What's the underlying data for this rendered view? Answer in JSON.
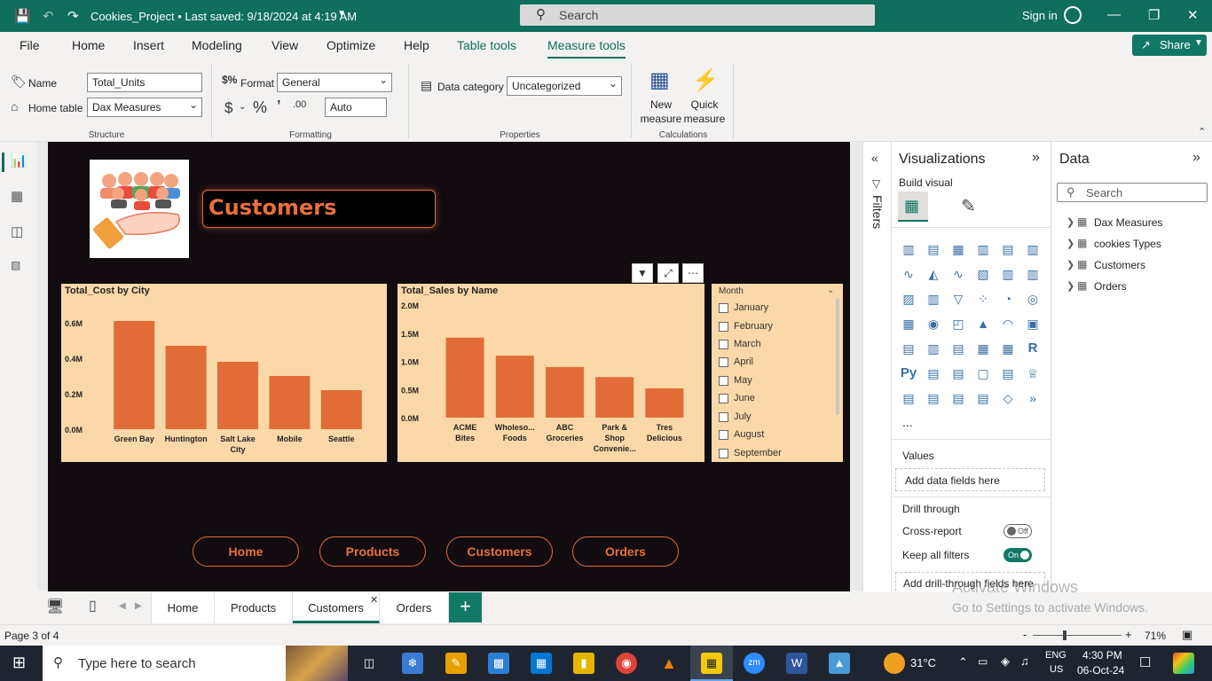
{
  "titlebar": {
    "doc_title": "Cookies_Project • Last saved: 9/18/2024 at 4:19 AM",
    "search_placeholder": "Search",
    "signin": "Sign in"
  },
  "menu": {
    "items": [
      "File",
      "Home",
      "Insert",
      "Modeling",
      "View",
      "Optimize",
      "Help",
      "Table tools",
      "Measure tools"
    ],
    "active": "Measure tools",
    "share": "Share"
  },
  "ribbon": {
    "name_label": "Name",
    "name_value": "Total_Units",
    "home_table_label": "Home table",
    "home_table_value": "Dax Measures",
    "format_label": "Format",
    "format_value": "General",
    "decimal_value": "Auto",
    "data_category_label": "Data category",
    "data_category_value": "Uncategorized",
    "new_measure": "New measure",
    "quick_measure": "Quick measure",
    "groups": {
      "structure": "Structure",
      "formatting": "Formatting",
      "properties": "Properties",
      "calculations": "Calculations"
    }
  },
  "report": {
    "title": "Customers",
    "nav_buttons": [
      "Home",
      "Products",
      "Customers",
      "Orders"
    ]
  },
  "chart_data": [
    {
      "type": "bar",
      "title": "Total_Cost by City",
      "categories": [
        "Green Bay",
        "Huntington",
        "Salt Lake City",
        "Mobile",
        "Seattle"
      ],
      "values": [
        0.61,
        0.47,
        0.38,
        0.3,
        0.22
      ],
      "y_ticks": [
        "0.6M",
        "0.4M",
        "0.2M",
        "0.0M"
      ],
      "ylim": [
        0,
        0.6
      ],
      "unit": "M",
      "color": "#e26c38"
    },
    {
      "type": "bar",
      "title": "Total_Sales by Name",
      "categories": [
        "ACME Bites",
        "Wholeso... Foods",
        "ABC Groceries",
        "Park & Shop Convenie...",
        "Tres Delicious"
      ],
      "values": [
        1.42,
        1.1,
        0.9,
        0.72,
        0.52
      ],
      "y_ticks": [
        "2.0M",
        "1.5M",
        "1.0M",
        "0.5M",
        "0.0M"
      ],
      "ylim": [
        0,
        2.0
      ],
      "unit": "M",
      "color": "#e26c38"
    }
  ],
  "slicer": {
    "title": "Month",
    "items": [
      "January",
      "February",
      "March",
      "April",
      "May",
      "June",
      "July",
      "August",
      "September"
    ]
  },
  "filters": {
    "label": "Filters"
  },
  "visualizations": {
    "title": "Visualizations",
    "build_visual": "Build visual",
    "values_label": "Values",
    "values_placeholder": "Add data fields here",
    "drill_through": "Drill through",
    "cross_report": "Cross-report",
    "cross_report_state": "Off",
    "keep_filters": "Keep all filters",
    "keep_filters_state": "On",
    "drill_placeholder": "Add drill-through fields here",
    "more": "..."
  },
  "data_pane": {
    "title": "Data",
    "search_placeholder": "Search",
    "tables": [
      "Dax Measures",
      "cookies Types",
      "Customers",
      "Orders"
    ]
  },
  "pages": {
    "tabs": [
      "Home",
      "Products",
      "Customers",
      "Orders"
    ],
    "active": "Customers",
    "status": "Page 3 of 4",
    "zoom": "71%"
  },
  "watermark": {
    "line1": "Activate Windows",
    "line2": "Go to Settings to activate Windows."
  },
  "taskbar": {
    "search_placeholder": "Type here to search",
    "weather": "31°C",
    "lang1": "ENG",
    "lang2": "US",
    "time": "4:30 PM",
    "date": "06-Oct-24"
  }
}
